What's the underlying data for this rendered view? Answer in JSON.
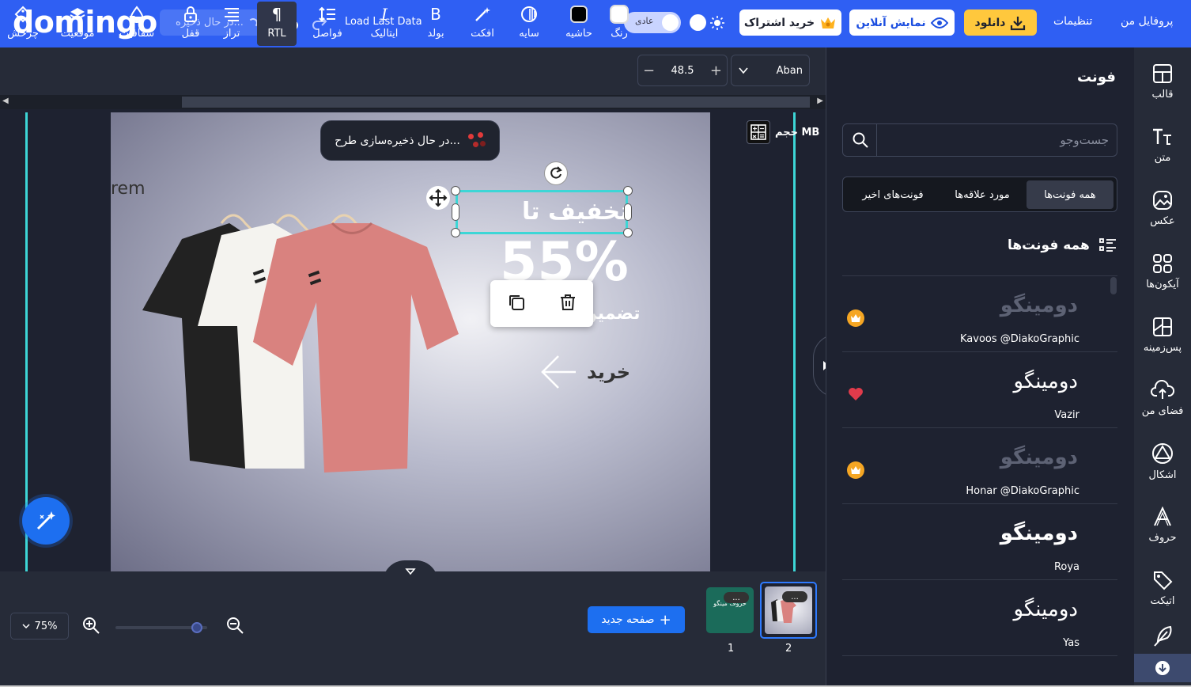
{
  "app": {
    "brand": "domingo",
    "accent": "#2f5ff3"
  },
  "topbar": {
    "save_status": "در حال ذخیره...",
    "load_last": "Load Last Data",
    "mode_label": "عادی",
    "subscribe": "خرید اشتراک",
    "preview": "نمایش آنلاین",
    "download": "دانلود",
    "settings": "تنظیمات",
    "profile": "پروفایل من"
  },
  "toolbar": {
    "tools": [
      {
        "label": "چرخش",
        "icon": "rotate-tag-icon"
      },
      {
        "label": "موقعیت",
        "icon": "layers-icon"
      },
      {
        "label": "شفافیت",
        "icon": "opacity-drop-icon"
      },
      {
        "label": "قفل",
        "icon": "lock-icon"
      },
      {
        "label": "تراز",
        "icon": "align-icon"
      },
      {
        "label": "RTL",
        "icon": "rtl-pilcrow-icon"
      },
      {
        "label": "فواصل",
        "icon": "line-spacing-icon"
      },
      {
        "label": "ایتالیک",
        "icon": "italic-icon"
      },
      {
        "label": "بولد",
        "icon": "bold-icon"
      },
      {
        "label": "افکت",
        "icon": "magic-wand-icon"
      },
      {
        "label": "سایه",
        "icon": "shadow-icon"
      },
      {
        "label": "حاشیه",
        "icon": "border-square-icon"
      },
      {
        "label": "رنگ",
        "icon": "color-swatch-icon"
      }
    ],
    "font_size": "48.5",
    "font_name": "Aban"
  },
  "canvas": {
    "saving_message": "در حال ذخیره‌سازی طرح...",
    "size_label": "حجم MB",
    "design": {
      "side_text": "rem",
      "headline": "تخفیف تا",
      "percent": "55%",
      "guarantee": "تضمین",
      "buy": "خرید"
    }
  },
  "bottom": {
    "zoom": "75%",
    "new_page": "صفحه جدید",
    "pages": [
      {
        "number": "1",
        "thumb_text": "حروف مینگو"
      },
      {
        "number": "2"
      }
    ],
    "more": "..."
  },
  "panel": {
    "title": "فونت",
    "search_placeholder": "جست‌وجو",
    "tabs": [
      "همه فونت‌ها",
      "مورد علاقه‌ها",
      "فونت‌های اخیر"
    ],
    "list_heading": "همه فونت‌ها",
    "fonts": [
      {
        "preview": "دومینگو",
        "name": "Kavoos @DiakoGraphic",
        "badge": "crown",
        "badge_color": "#f5a623"
      },
      {
        "preview": "دومینگو",
        "name": "Vazir",
        "badge": "heart",
        "badge_color": "#e03b4b"
      },
      {
        "preview": "دومینگو",
        "name": "Honar @DiakoGraphic",
        "badge": "crown",
        "badge_color": "#f5a623"
      },
      {
        "preview": "دومینگو",
        "name": "Roya",
        "badge": ""
      },
      {
        "preview": "دومینگو",
        "name": "Yas",
        "badge": ""
      }
    ]
  },
  "nav": {
    "items": [
      {
        "label": "قالب",
        "icon": "template-icon"
      },
      {
        "label": "متن",
        "icon": "text-icon"
      },
      {
        "label": "عکس",
        "icon": "image-icon"
      },
      {
        "label": "آیکون‌ها",
        "icon": "icons-grid-icon"
      },
      {
        "label": "پس‌زمینه",
        "icon": "background-icon"
      },
      {
        "label": "فضای من",
        "icon": "cloud-upload-icon"
      },
      {
        "label": "اشکال",
        "icon": "shapes-icon"
      },
      {
        "label": "حروف",
        "icon": "letters-icon"
      },
      {
        "label": "اتیکت",
        "icon": "tag-icon"
      }
    ]
  }
}
